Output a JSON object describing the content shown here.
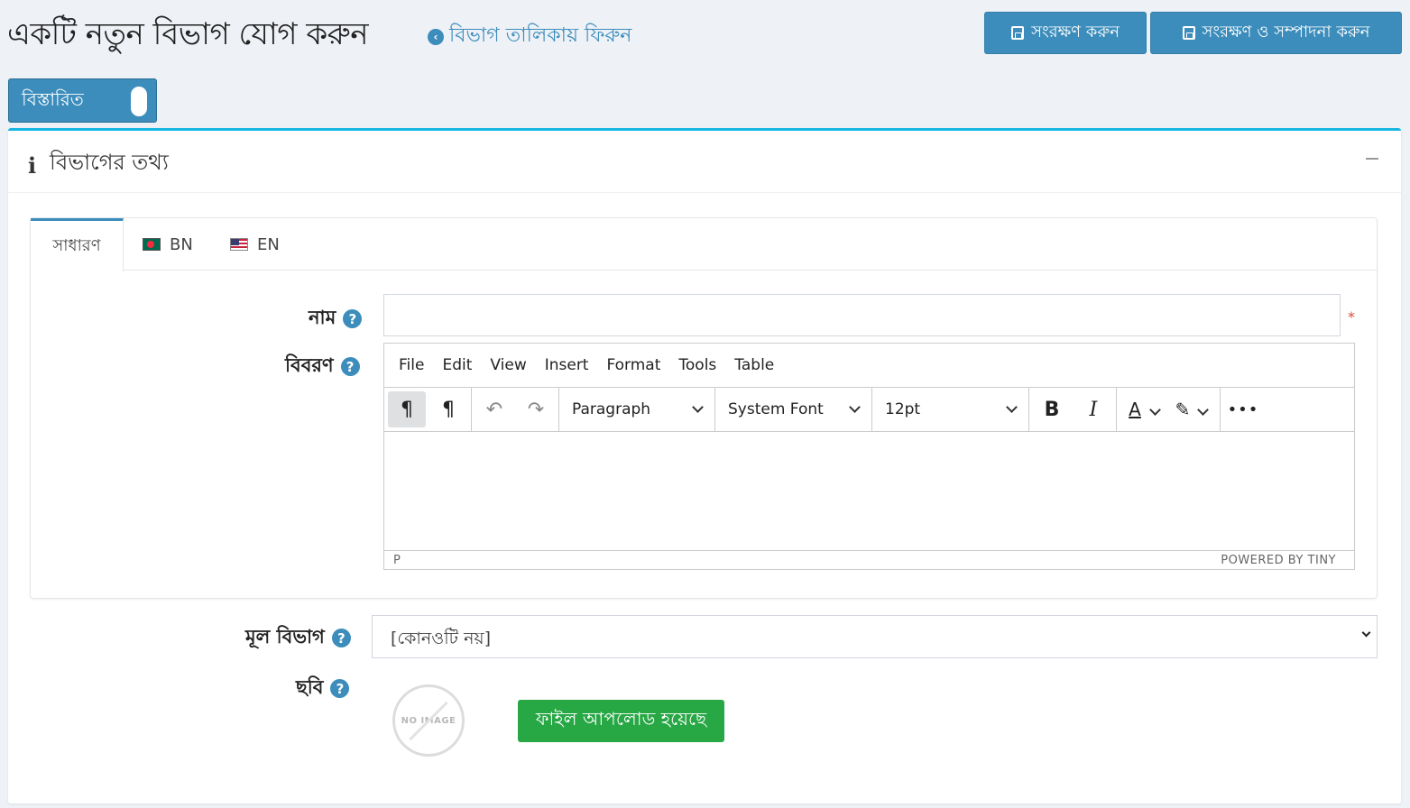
{
  "header": {
    "title": "একটি নতুন বিভাগ যোগ করুন",
    "back_link": "বিভাগ তালিকায় ফিরুন",
    "save_label": "সংরক্ষণ করুন",
    "save_edit_label": "সংরক্ষণ ও সম্পাদনা করুন"
  },
  "toggle": {
    "label": "বিস্তারিত"
  },
  "card": {
    "title": "বিভাগের তথ্য"
  },
  "tabs": [
    {
      "label": "সাধারণ"
    },
    {
      "label": "BN"
    },
    {
      "label": "EN"
    }
  ],
  "form": {
    "name_label": "নাম",
    "name_value": "",
    "description_label": "বিবরণ",
    "parent_label": "মূল বিভাগ",
    "parent_value": "[কোনওটি নয়]",
    "picture_label": "ছবি",
    "required_mark": "*",
    "no_image_text": "NO IMAGE",
    "upload_label": "ফাইল আপলোড হয়েছে"
  },
  "editor": {
    "menu": [
      "File",
      "Edit",
      "View",
      "Insert",
      "Format",
      "Tools",
      "Table"
    ],
    "block_format": "Paragraph",
    "font_family": "System Font",
    "font_size": "12pt",
    "status_path": "P",
    "powered_by": "POWERED BY TINY"
  },
  "colors": {
    "primary": "#3c8dbc",
    "success": "#28a745",
    "accent_top": "#17b6e0"
  }
}
